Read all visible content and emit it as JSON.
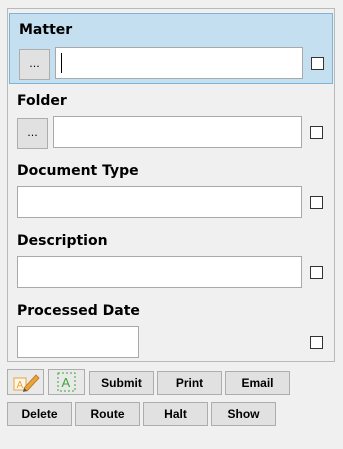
{
  "form": {
    "fields": [
      {
        "label": "Matter",
        "value": "",
        "has_browse": true,
        "browse_label": "..."
      },
      {
        "label": "Folder",
        "value": "",
        "has_browse": true,
        "browse_label": "..."
      },
      {
        "label": "Document Type",
        "value": "",
        "has_browse": false
      },
      {
        "label": "Description",
        "value": "",
        "has_browse": false
      },
      {
        "label": "Processed Date",
        "value": "",
        "has_browse": false
      }
    ]
  },
  "toolbar": {
    "icons": [
      "edit-text-icon",
      "text-select-icon"
    ],
    "row1_buttons": [
      "Submit",
      "Print",
      "Email"
    ],
    "row2_buttons": [
      "Delete",
      "Route",
      "Halt",
      "Show"
    ]
  },
  "colors": {
    "active_row_bg": "#c4dff0",
    "active_row_border": "#7fb3d5",
    "window_bg": "#f0f0f0",
    "icon_orange": "#e8a33c",
    "icon_green": "#38a838"
  }
}
